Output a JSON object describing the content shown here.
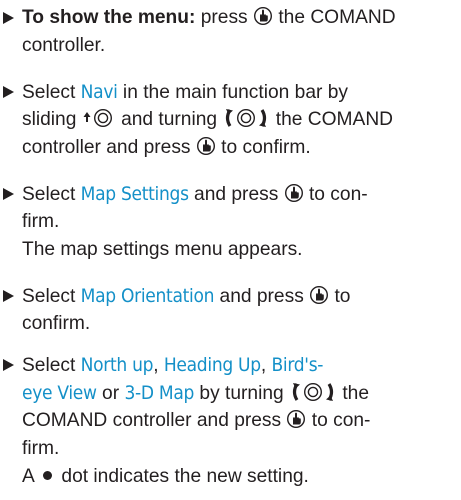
{
  "colors": {
    "text": "#231f20",
    "highlight": "#1490c8"
  },
  "steps": [
    {
      "lead": "To show the menu:",
      "l1a": " press ",
      "l1b": " the COMAND",
      "l2": "controller."
    },
    {
      "l1a": "Select ",
      "navi": "Navi",
      "l1b": " in the main function bar by",
      "l2a": "sliding ",
      "l2b": " and turning ",
      "l2c": " the COMAND",
      "l3a": "controller and press ",
      "l3b": " to confirm."
    },
    {
      "l1a": "Select ",
      "map_settings": "Map Settings",
      "l1b": " and press ",
      "l1c": " to con-",
      "l2": "firm.",
      "result": "The map settings menu appears."
    },
    {
      "l1a": "Select ",
      "map_orientation": "Map Orientation",
      "l1b": " and press ",
      "l1c": " to",
      "l2": "confirm."
    },
    {
      "l1a": "Select ",
      "opt1": "North up",
      "sep1": ", ",
      "opt2": "Heading Up",
      "sep2": ", ",
      "opt3a": "Bird's-",
      "opt3b": "eye View",
      "or": " or ",
      "opt4": "3-D Map",
      "l2b": " by turning ",
      "l2c": " the",
      "l3": "COMAND controller and press ",
      "l3b": " to con-",
      "l4": "firm.",
      "result_a": "A ",
      "result_b": " dot indicates the new setting."
    }
  ],
  "icons": {
    "press": "press-controller-icon",
    "slide_up": "slide-up-controller-icon",
    "turn": "turn-controller-icon",
    "dot": "filled-dot-icon"
  }
}
